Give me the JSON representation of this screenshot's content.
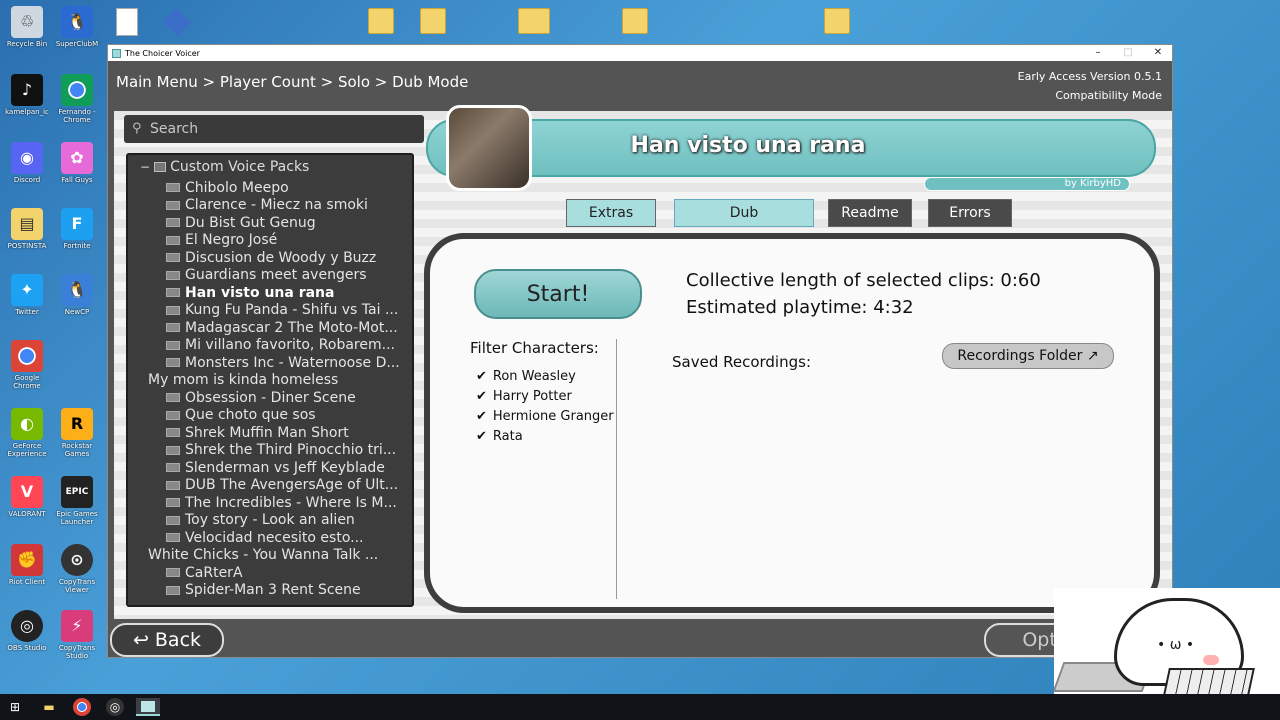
{
  "desktop": {
    "left_icons": [
      {
        "label": "Recycle Bin",
        "icon": "recycle-bin-icon"
      },
      {
        "label": "kamelpan_ic",
        "icon": "tiktok-icon"
      },
      {
        "label": "Discord",
        "icon": "discord-icon"
      },
      {
        "label": "POSTINSTA",
        "icon": "document-icon"
      },
      {
        "label": "Twitter",
        "icon": "twitter-icon"
      },
      {
        "label": "Google Chrome",
        "icon": "chrome-icon"
      },
      {
        "label": "GeForce Experience",
        "icon": "nvidia-icon"
      },
      {
        "label": "VALORANT",
        "icon": "valorant-icon"
      },
      {
        "label": "Riot Client",
        "icon": "riot-icon"
      },
      {
        "label": "OBS Studio",
        "icon": "obs-icon"
      }
    ],
    "right_icons": [
      {
        "label": "SuperClubM",
        "icon": "penguin-icon"
      },
      {
        "label": "Fernando - Chrome",
        "icon": "chrome-icon"
      },
      {
        "label": "Fall Guys",
        "icon": "fallguys-icon"
      },
      {
        "label": "Fortnite",
        "icon": "fortnite-icon"
      },
      {
        "label": "NewCP",
        "icon": "penguin-icon"
      },
      {
        "label": "Rockstar Games",
        "icon": "rockstar-icon"
      },
      {
        "label": "Epic Games Launcher",
        "icon": "epic-icon"
      },
      {
        "label": "CopyTrans Viewer",
        "icon": "copytrans-icon"
      },
      {
        "label": "CopyTrans Studio",
        "icon": "copytrans-icon"
      }
    ]
  },
  "window": {
    "title": "The Choicer Voicer",
    "minimize": "–",
    "maximize": "□",
    "close": "✕"
  },
  "app": {
    "breadcrumb": "Main Menu > Player Count > Solo > Dub Mode",
    "version": "Early Access Version 0.5.1",
    "mode": "Compatibility Mode",
    "search_placeholder": "Search",
    "tree_root": "Custom Voice Packs",
    "packs": [
      {
        "label": "Chibolo Meepo",
        "thumb": true,
        "selected": false
      },
      {
        "label": "Clarence - Miecz na smoki",
        "thumb": true,
        "selected": false
      },
      {
        "label": "Du Bist Gut Genug",
        "thumb": true,
        "selected": false
      },
      {
        "label": "El Negro José",
        "thumb": true,
        "selected": false
      },
      {
        "label": "Discusion de Woody y Buzz",
        "thumb": true,
        "selected": false
      },
      {
        "label": "Guardians meet avengers",
        "thumb": true,
        "selected": false
      },
      {
        "label": "Han visto una rana",
        "thumb": true,
        "selected": true
      },
      {
        "label": "Kung Fu Panda - Shifu vs Tai ...",
        "thumb": true,
        "selected": false
      },
      {
        "label": "Madagascar 2 The Moto-Mot...",
        "thumb": true,
        "selected": false
      },
      {
        "label": "Mi villano favorito, Robarem...",
        "thumb": true,
        "selected": false
      },
      {
        "label": "Monsters Inc - Waternoose D...",
        "thumb": true,
        "selected": false
      },
      {
        "label": "My mom is kinda homeless",
        "thumb": false,
        "selected": false
      },
      {
        "label": "Obsession - Diner Scene",
        "thumb": true,
        "selected": false
      },
      {
        "label": "Que choto que sos",
        "thumb": true,
        "selected": false
      },
      {
        "label": "Shrek Muffin Man Short",
        "thumb": true,
        "selected": false
      },
      {
        "label": "Shrek the Third Pinocchio tri...",
        "thumb": true,
        "selected": false
      },
      {
        "label": "Slenderman vs Jeff Keyblade",
        "thumb": true,
        "selected": false
      },
      {
        "label": "DUB The AvengersAge of Ult...",
        "thumb": true,
        "selected": false
      },
      {
        "label": "The Incredibles - Where Is M...",
        "thumb": true,
        "selected": false
      },
      {
        "label": "Toy story - Look an alien",
        "thumb": true,
        "selected": false
      },
      {
        "label": "Velocidad necesito esto...",
        "thumb": true,
        "selected": false
      },
      {
        "label": "White Chicks - You Wanna Talk ...",
        "thumb": false,
        "selected": false
      },
      {
        "label": "CaRterA",
        "thumb": true,
        "selected": false
      },
      {
        "label": "Spider-Man 3 Rent Scene",
        "thumb": true,
        "selected": false
      }
    ],
    "pack_title": "Han visto una rana",
    "author": "by KirbyHD",
    "tabs": {
      "extras": "Extras",
      "dub": "Dub",
      "readme": "Readme",
      "errors": "Errors"
    },
    "start": "Start!",
    "collective_length": "Collective length of selected clips:  0:60",
    "estimated_playtime": "Estimated playtime:  4:32",
    "filter_label": "Filter Characters:",
    "characters": [
      "Ron Weasley",
      "Harry Potter",
      "Hermione Granger",
      "Rata"
    ],
    "saved_label": "Saved Recordings:",
    "recordings_folder": "Recordings Folder ↗",
    "back": "Back",
    "options": "Options"
  },
  "taskbar": {
    "items": [
      "windows-start-icon",
      "file-explorer-icon",
      "chrome-icon",
      "obs-icon",
      "choicer-voicer-icon"
    ]
  }
}
